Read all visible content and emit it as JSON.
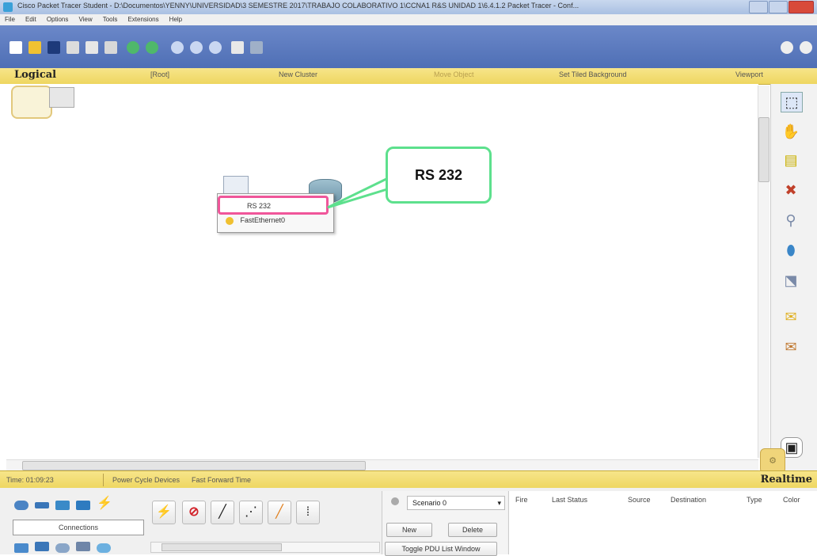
{
  "window": {
    "title": "Cisco Packet Tracer Student - D:\\Documentos\\YENNY\\UNIVERSIDAD\\3 SEMESTRE 2017\\TRABAJO COLABORATIVO 1\\CCNA1 R&S UNIDAD 1\\6.4.1.2 Packet Tracer - Conf..."
  },
  "menu": [
    "File",
    "Edit",
    "Options",
    "View",
    "Tools",
    "Extensions",
    "Help"
  ],
  "logical_bar": {
    "logical": "Logical",
    "root": "[Root]",
    "new_cluster": "New Cluster",
    "move_object": "Move Object",
    "set_tiled_background": "Set Tiled Background",
    "viewport": "Viewport"
  },
  "context_menu": {
    "items": [
      "RS 232",
      "FastEthernet0"
    ]
  },
  "callout": {
    "text": "RS 232"
  },
  "time_bar": {
    "time": "Time: 01:09:23",
    "power_cycle": "Power Cycle Devices",
    "fast_forward": "Fast Forward Time",
    "realtime": "Realtime"
  },
  "bottom": {
    "connections_label": "Connections",
    "scenario": "Scenario 0",
    "new_button": "New",
    "delete_button": "Delete",
    "toggle_pdu": "Toggle PDU List Window",
    "pdu_columns": [
      "Fire",
      "Last Status",
      "Source",
      "Destination",
      "Type",
      "Color"
    ]
  },
  "colors": {
    "highlight": "#f0569a",
    "callout_border": "#5de08d",
    "toolbar": "#5874b8",
    "yellow_bar": "#f2dc6e"
  }
}
